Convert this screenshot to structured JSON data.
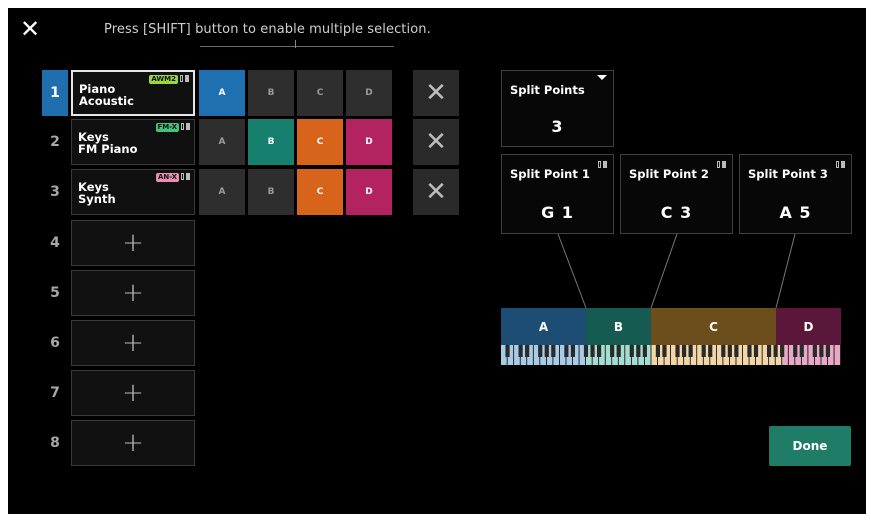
{
  "header": {
    "close_icon": "close-icon",
    "hint": "Press [SHIFT] button to enable multiple selection."
  },
  "parts": [
    {
      "num": "1",
      "line1": "Piano",
      "line2": "Acoustic",
      "badge": "AWM2",
      "badge_type": "awm",
      "selected": true,
      "empty": false,
      "zones": [
        "A",
        "B",
        "C",
        "D"
      ],
      "zones_on": [
        true,
        false,
        false,
        false
      ]
    },
    {
      "num": "2",
      "line1": "Keys",
      "line2": "FM Piano",
      "badge": "FM-X",
      "badge_type": "fmx",
      "selected": false,
      "empty": false,
      "zones": [
        "A",
        "B",
        "C",
        "D"
      ],
      "zones_on": [
        false,
        true,
        true,
        true
      ]
    },
    {
      "num": "3",
      "line1": "Keys",
      "line2": "Synth",
      "badge": "AN-X",
      "badge_type": "anx",
      "selected": false,
      "empty": false,
      "zones": [
        "A",
        "B",
        "C",
        "D"
      ],
      "zones_on": [
        false,
        false,
        true,
        true
      ]
    },
    {
      "num": "4",
      "empty": true
    },
    {
      "num": "5",
      "empty": true
    },
    {
      "num": "6",
      "empty": true
    },
    {
      "num": "7",
      "empty": true
    },
    {
      "num": "8",
      "empty": true
    }
  ],
  "zone_colors": {
    "A": "#1f70b0",
    "B": "#177f6e",
    "C": "#d8631a",
    "D": "#b2235f"
  },
  "split_points_selector": {
    "title": "Split Points",
    "value": "3"
  },
  "split_points": [
    {
      "title": "Split Point 1",
      "value": "G 1"
    },
    {
      "title": "Split Point 2",
      "value": "C 3"
    },
    {
      "title": "Split Point 3",
      "value": "A 5"
    }
  ],
  "keyboard_zones": [
    {
      "label": "A",
      "color": "#1d4d72"
    },
    {
      "label": "B",
      "color": "#155b52"
    },
    {
      "label": "C",
      "color": "#6b4e1c"
    },
    {
      "label": "D",
      "color": "#5a1739"
    }
  ],
  "done_label": "Done"
}
